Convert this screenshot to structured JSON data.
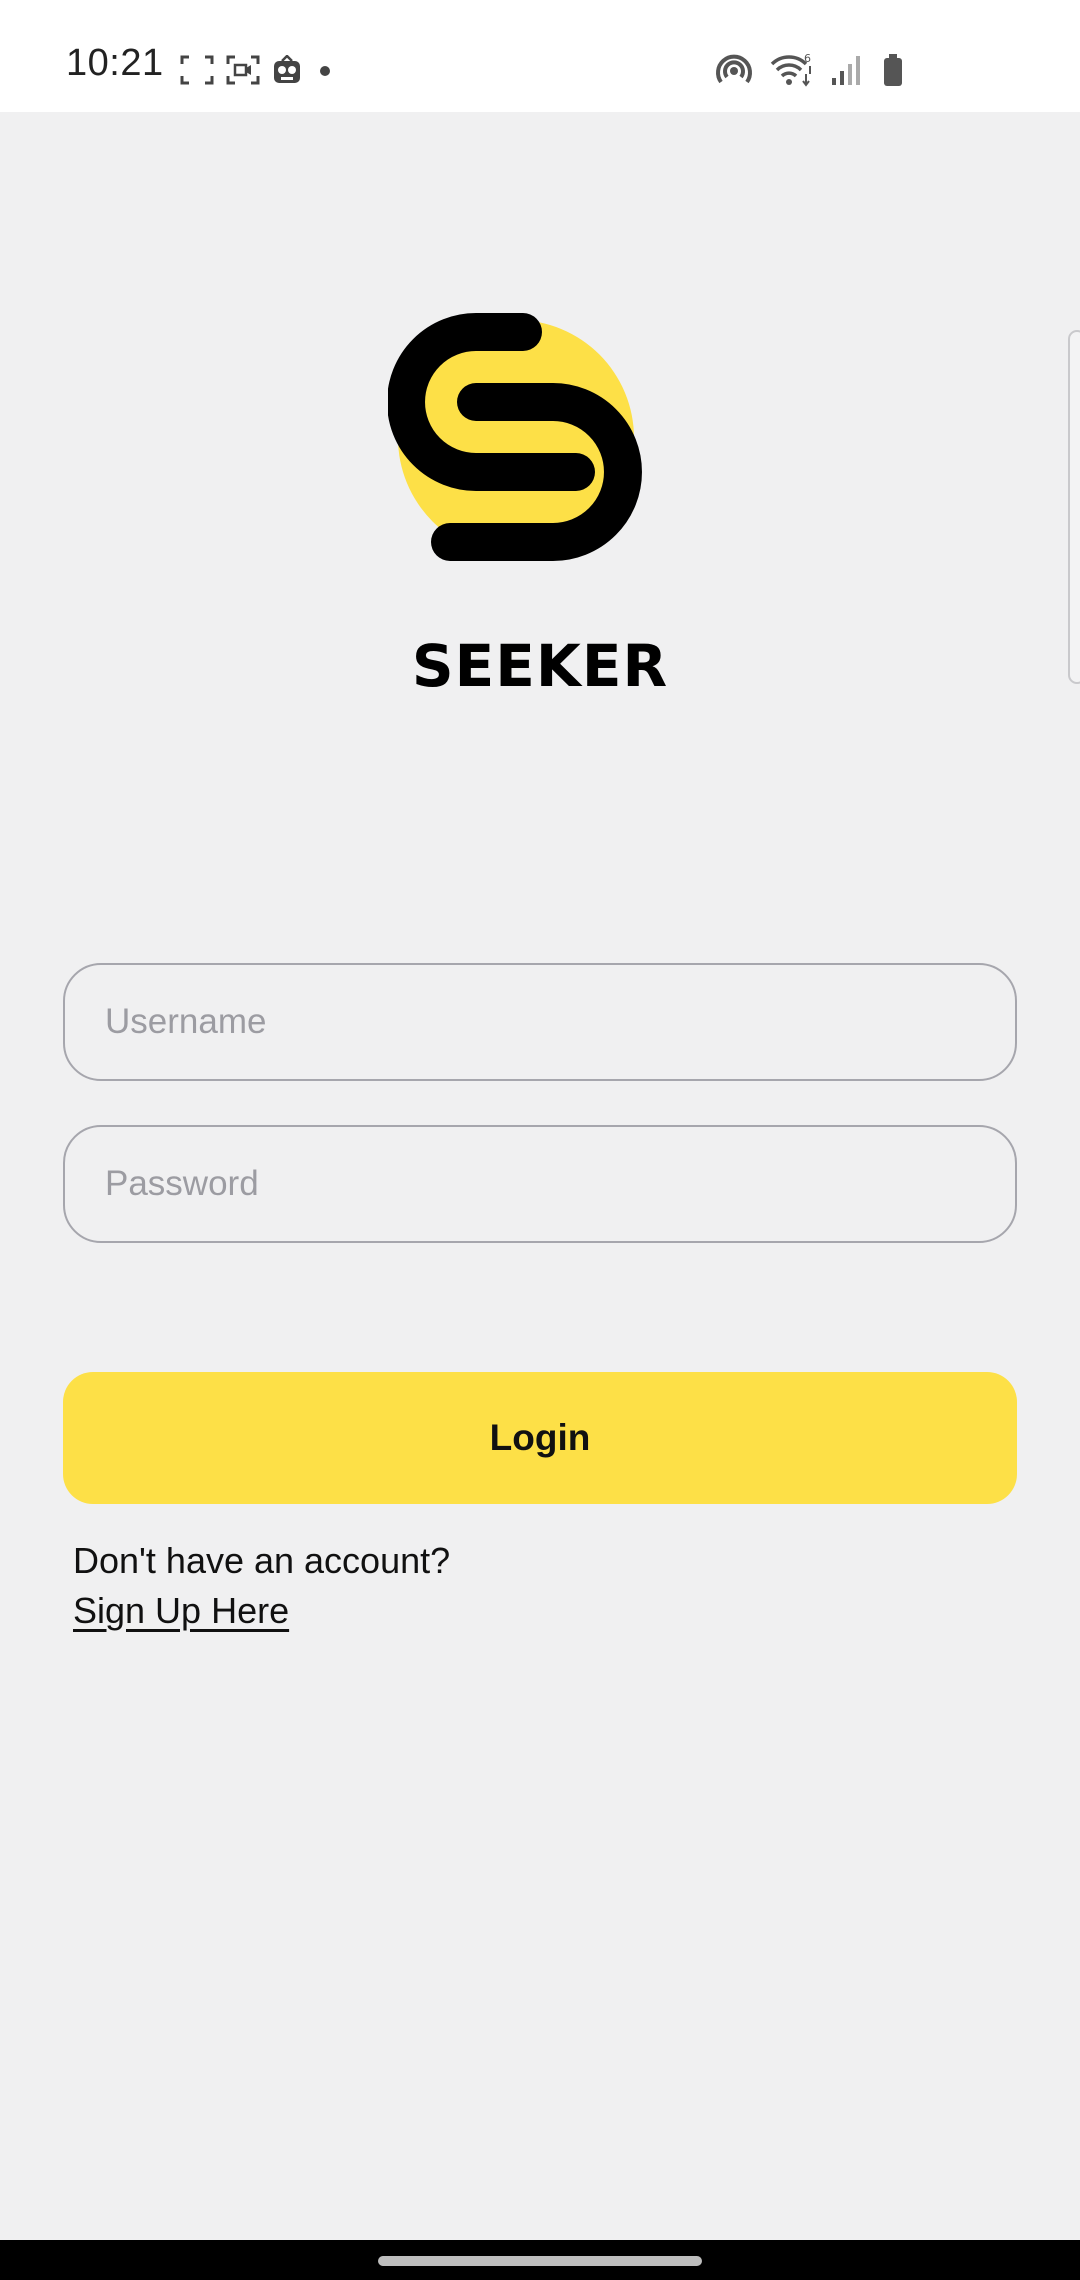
{
  "status_bar": {
    "time": "10:21",
    "left_icons": [
      "screenshot-frame-icon",
      "screen-record-icon",
      "app-notification-icon",
      "dot-icon"
    ],
    "right_icons": [
      "hotspot-icon",
      "wifi-6-icon",
      "signal-icon",
      "battery-icon"
    ]
  },
  "brand": {
    "name": "SEEKER",
    "colors": {
      "accent": "#fde047",
      "ink": "#000000"
    }
  },
  "form": {
    "username_placeholder": "Username",
    "username_value": "",
    "password_placeholder": "Password",
    "password_value": ""
  },
  "login_button": {
    "label": "Login"
  },
  "signup": {
    "prompt": "Don't have an account?",
    "link": "Sign Up Here"
  }
}
